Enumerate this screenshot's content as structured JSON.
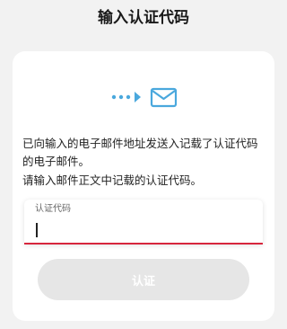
{
  "header": {
    "title": "输入认证代码"
  },
  "instructions": {
    "description": "已向输入的电子邮件地址发送入记载了认证代码的电子邮件。",
    "hint": "请输入邮件正文中记载的认证代码。"
  },
  "form": {
    "code_label": "认证代码",
    "code_value": "",
    "submit_label": "认证"
  },
  "colors": {
    "accent": "#4aa8dd",
    "error_underline": "#d7263d",
    "button_disabled": "#e6e6e6"
  },
  "icons": {
    "hero": "send-mail-icon"
  }
}
